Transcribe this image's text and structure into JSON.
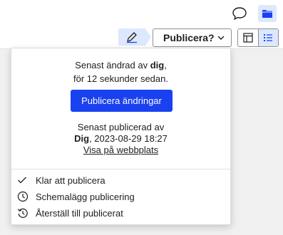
{
  "topbar": {
    "comment_icon": "speech-bubble-icon",
    "folder_icon": "folder-icon"
  },
  "toolbar": {
    "edit_icon": "pencil-icon",
    "publish_label": "Publicera?",
    "view_icons": [
      "layout-icon",
      "list-icon"
    ]
  },
  "popover": {
    "changed_prefix": "Senast ändrad av ",
    "changed_by": "dig",
    "changed_suffix": ",",
    "changed_time": "för 12 sekunder sedan.",
    "publish_button": "Publicera ändringar",
    "published_label": "Senast publicerad av",
    "published_by": "Dig",
    "published_date": ", 2023-08-29 18:27",
    "view_link": "Visa på webbplats",
    "menu": [
      {
        "label": "Klar att publicera",
        "icon": "check-icon"
      },
      {
        "label": "Schemalägg publicering",
        "icon": "clock-icon"
      },
      {
        "label": "Återställ till publicerat",
        "icon": "history-icon"
      }
    ]
  },
  "colors": {
    "accent": "#1a41f0",
    "accent_light": "#dde8ff"
  }
}
